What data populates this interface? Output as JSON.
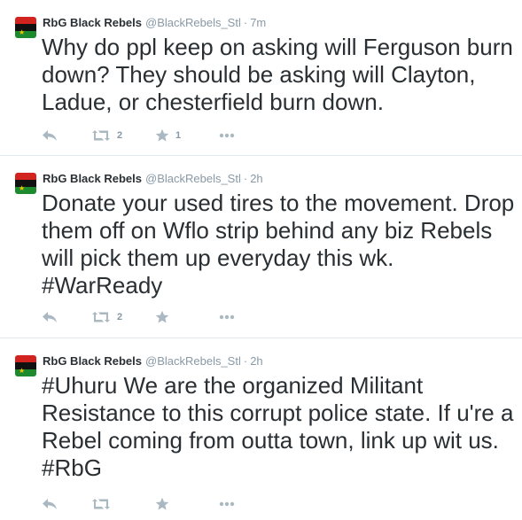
{
  "colors": {
    "text": "#292f33",
    "muted": "#8899a6",
    "icon": "#aab8c2",
    "divider": "#e1e8ed"
  },
  "tweets": [
    {
      "author": "RbG Black Rebels",
      "handle": "@BlackRebels_Stl",
      "dot": "·",
      "time": "7m",
      "text": "Why do ppl keep on asking will Ferguson burn down? They should be asking will Clayton, Ladue, or chesterfield burn down.",
      "retweets": "2",
      "favorites": "1"
    },
    {
      "author": "RbG Black Rebels",
      "handle": "@BlackRebels_Stl",
      "dot": "·",
      "time": "2h",
      "text": "Donate your used tires to the movement. Drop them off on Wflo strip behind any biz Rebels will pick them up everyday this wk. #WarReady",
      "retweets": "2",
      "favorites": ""
    },
    {
      "author": "RbG Black Rebels",
      "handle": "@BlackRebels_Stl",
      "dot": "·",
      "time": "2h",
      "text": "#Uhuru We are the organized Militant Resistance to this corrupt police state. If u're a Rebel coming from outta town, link up wit us. #RbG",
      "retweets": "",
      "favorites": ""
    }
  ],
  "icons": {
    "reply": "reply-icon",
    "retweet": "retweet-icon",
    "favorite": "star-icon",
    "more": "more-icon"
  }
}
